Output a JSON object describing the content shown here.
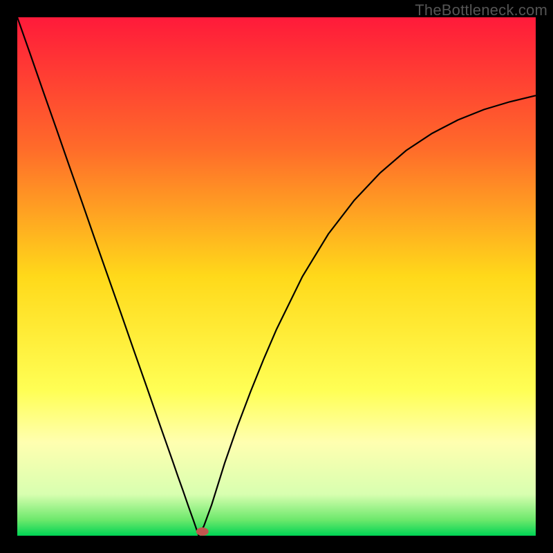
{
  "watermark": "TheBottleneck.com",
  "chart_data": {
    "type": "line",
    "title": "",
    "xlabel": "",
    "ylabel": "",
    "xlim": [
      0,
      100
    ],
    "ylim": [
      0,
      100
    ],
    "background_gradient": {
      "stops": [
        {
          "offset": 0,
          "color": "#ff1a3a"
        },
        {
          "offset": 25,
          "color": "#ff6a2a"
        },
        {
          "offset": 50,
          "color": "#ffd91a"
        },
        {
          "offset": 72,
          "color": "#ffff55"
        },
        {
          "offset": 82,
          "color": "#ffffb0"
        },
        {
          "offset": 92,
          "color": "#d8ffb0"
        },
        {
          "offset": 97,
          "color": "#6be86b"
        },
        {
          "offset": 100,
          "color": "#00d455"
        }
      ]
    },
    "series": [
      {
        "name": "bottleneck-curve",
        "color": "#000000",
        "width": 2.2,
        "x": [
          0,
          2.5,
          5,
          7.5,
          10,
          12.5,
          15,
          17.5,
          20,
          22.5,
          25,
          27.5,
          30,
          31,
          32,
          33,
          34,
          35,
          36,
          37.5,
          40,
          42.5,
          45,
          47.5,
          50,
          55,
          60,
          65,
          70,
          75,
          80,
          85,
          90,
          95,
          100
        ],
        "y": [
          100,
          92.9,
          85.7,
          78.6,
          71.4,
          64.3,
          57.1,
          50,
          42.9,
          35.7,
          28.6,
          21.4,
          14.3,
          11.4,
          8.6,
          5.7,
          2.9,
          0,
          1.9,
          6,
          14,
          21.2,
          27.8,
          34,
          39.8,
          50,
          58.2,
          64.7,
          70,
          74.3,
          77.6,
          80.2,
          82.2,
          83.7,
          84.9
        ]
      }
    ],
    "marker": {
      "name": "optimal-point",
      "x": 35.7,
      "y": 0.8,
      "rx": 9,
      "ry": 6,
      "color": "#c0574f"
    }
  }
}
